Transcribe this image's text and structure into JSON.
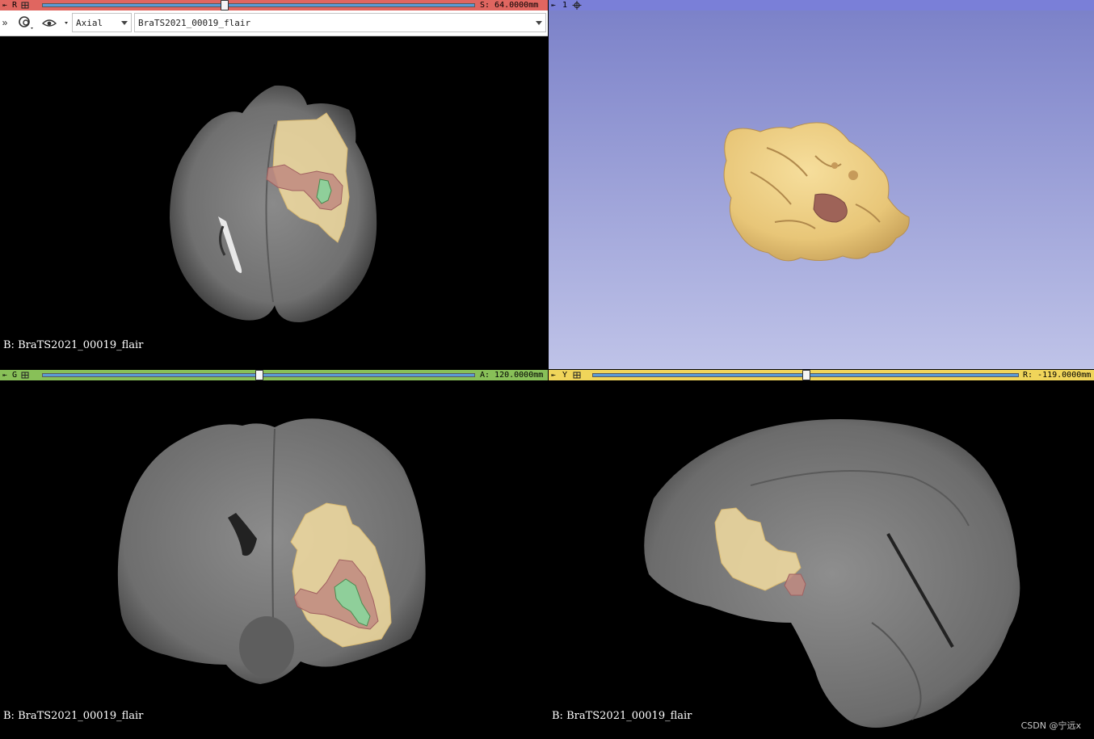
{
  "red_view": {
    "label": "R",
    "offset": "S: 64.0000mm",
    "slider_fraction": 0.42,
    "orientation": "Axial",
    "volume": "BraTS2021_00019_flair",
    "caption": "B: BraTS2021_00019_flair",
    "colors": {
      "bar": "#e06660",
      "track": "#5b9bd5"
    }
  },
  "threed_view": {
    "label": "1",
    "colors": {
      "bar": "#7a7fd8",
      "bg_top": "#7a80c8",
      "bg_bottom": "#bfc3e8"
    }
  },
  "green_view": {
    "label": "G",
    "offset": "A: 120.0000mm",
    "slider_fraction": 0.5,
    "caption": "B: BraTS2021_00019_flair",
    "colors": {
      "bar": "#88c058",
      "track": "#5b9bd5"
    }
  },
  "yellow_view": {
    "label": "Y",
    "offset": "R: -119.0000mm",
    "slider_fraction": 0.5,
    "caption": "B: BraTS2021_00019_flair",
    "colors": {
      "bar": "#f0d55a",
      "track": "#5b9bd5"
    }
  },
  "icons": {
    "pin": "pin-icon",
    "more": "more-icon",
    "link": "link-icon",
    "visibility": "eye-icon",
    "layout": "layout-grid-icon",
    "settings": "gear-icon"
  },
  "segment_colors": {
    "edema": "#f2dca0",
    "necrosis": "#c08a80",
    "enhancing": "#8fcf9a"
  },
  "watermark": "CSDN @宁远x"
}
